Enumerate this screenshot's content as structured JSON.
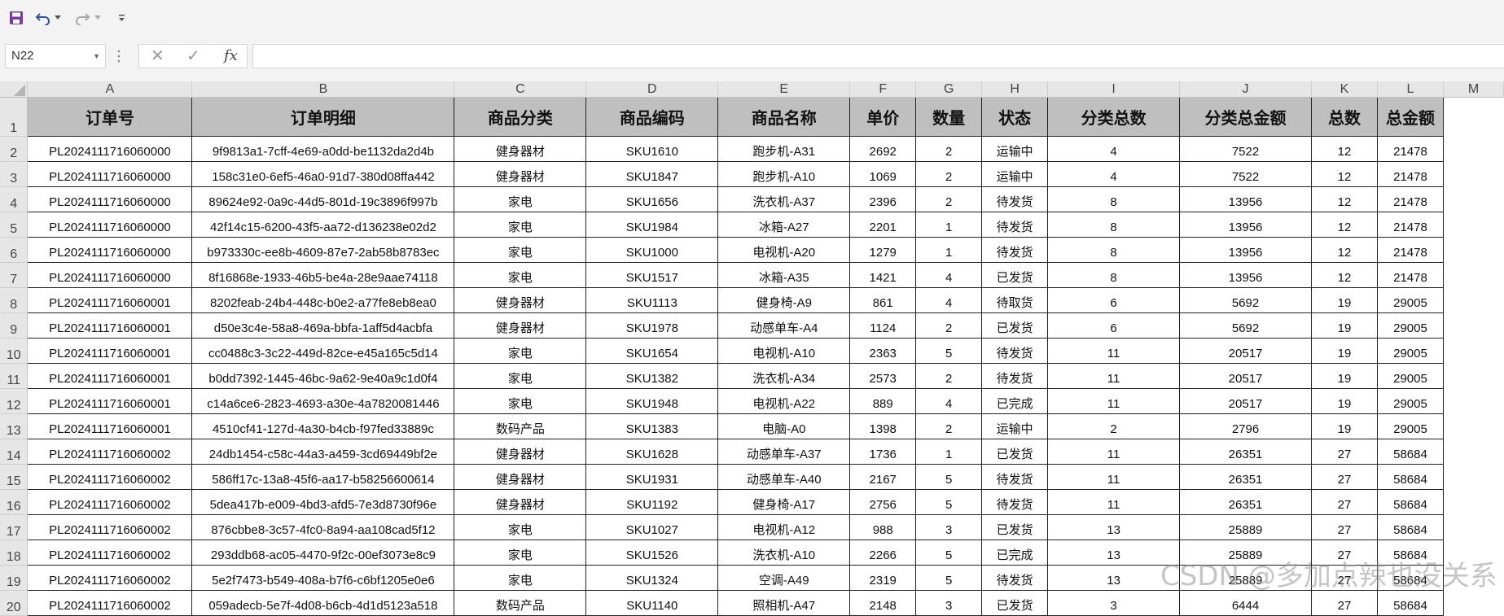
{
  "app": {
    "accent": "#217346",
    "save_color": "#7a3c9e"
  },
  "formula_bar": {
    "name_box": "N22",
    "cancel_symbol": "✕",
    "enter_symbol": "✓",
    "fx_label": "fx",
    "formula_value": ""
  },
  "columns": [
    "A",
    "B",
    "C",
    "D",
    "E",
    "F",
    "G",
    "H",
    "I",
    "J",
    "K",
    "L",
    "M"
  ],
  "row_numbers": [
    "1",
    "2",
    "3",
    "4",
    "5",
    "6",
    "7",
    "8",
    "9",
    "10",
    "11",
    "12",
    "13",
    "14",
    "15",
    "16",
    "17",
    "18",
    "19",
    "20"
  ],
  "header": [
    "订单号",
    "订单明细",
    "商品分类",
    "商品编码",
    "商品名称",
    "单价",
    "数量",
    "状态",
    "分类总数",
    "分类总金额",
    "总数",
    "总金额"
  ],
  "rows": [
    [
      "PL2024111716060000",
      "9f9813a1-7cff-4e69-a0dd-be1132da2d4b",
      "健身器材",
      "SKU1610",
      "跑步机-A31",
      "2692",
      "2",
      "运输中",
      "4",
      "7522",
      "12",
      "21478"
    ],
    [
      "PL2024111716060000",
      "158c31e0-6ef5-46a0-91d7-380d08ffa442",
      "健身器材",
      "SKU1847",
      "跑步机-A10",
      "1069",
      "2",
      "运输中",
      "4",
      "7522",
      "12",
      "21478"
    ],
    [
      "PL2024111716060000",
      "89624e92-0a9c-44d5-801d-19c3896f997b",
      "家电",
      "SKU1656",
      "洗衣机-A37",
      "2396",
      "2",
      "待发货",
      "8",
      "13956",
      "12",
      "21478"
    ],
    [
      "PL2024111716060000",
      "42f14c15-6200-43f5-aa72-d136238e02d2",
      "家电",
      "SKU1984",
      "冰箱-A27",
      "2201",
      "1",
      "待发货",
      "8",
      "13956",
      "12",
      "21478"
    ],
    [
      "PL2024111716060000",
      "b973330c-ee8b-4609-87e7-2ab58b8783ec",
      "家电",
      "SKU1000",
      "电视机-A20",
      "1279",
      "1",
      "待发货",
      "8",
      "13956",
      "12",
      "21478"
    ],
    [
      "PL2024111716060000",
      "8f16868e-1933-46b5-be4a-28e9aae74118",
      "家电",
      "SKU1517",
      "冰箱-A35",
      "1421",
      "4",
      "已发货",
      "8",
      "13956",
      "12",
      "21478"
    ],
    [
      "PL2024111716060001",
      "8202feab-24b4-448c-b0e2-a77fe8eb8ea0",
      "健身器材",
      "SKU1113",
      "健身椅-A9",
      "861",
      "4",
      "待取货",
      "6",
      "5692",
      "19",
      "29005"
    ],
    [
      "PL2024111716060001",
      "d50e3c4e-58a8-469a-bbfa-1aff5d4acbfa",
      "健身器材",
      "SKU1978",
      "动感单车-A4",
      "1124",
      "2",
      "已发货",
      "6",
      "5692",
      "19",
      "29005"
    ],
    [
      "PL2024111716060001",
      "cc0488c3-3c22-449d-82ce-e45a165c5d14",
      "家电",
      "SKU1654",
      "电视机-A10",
      "2363",
      "5",
      "待发货",
      "11",
      "20517",
      "19",
      "29005"
    ],
    [
      "PL2024111716060001",
      "b0dd7392-1445-46bc-9a62-9e40a9c1d0f4",
      "家电",
      "SKU1382",
      "洗衣机-A34",
      "2573",
      "2",
      "待发货",
      "11",
      "20517",
      "19",
      "29005"
    ],
    [
      "PL2024111716060001",
      "c14a6ce6-2823-4693-a30e-4a7820081446",
      "家电",
      "SKU1948",
      "电视机-A22",
      "889",
      "4",
      "已完成",
      "11",
      "20517",
      "19",
      "29005"
    ],
    [
      "PL2024111716060001",
      "4510cf41-127d-4a30-b4cb-f97fed33889c",
      "数码产品",
      "SKU1383",
      "电脑-A0",
      "1398",
      "2",
      "运输中",
      "2",
      "2796",
      "19",
      "29005"
    ],
    [
      "PL2024111716060002",
      "24db1454-c58c-44a3-a459-3cd69449bf2e",
      "健身器材",
      "SKU1628",
      "动感单车-A37",
      "1736",
      "1",
      "已发货",
      "11",
      "26351",
      "27",
      "58684"
    ],
    [
      "PL2024111716060002",
      "586ff17c-13a8-45f6-aa17-b58256600614",
      "健身器材",
      "SKU1931",
      "动感单车-A40",
      "2167",
      "5",
      "待发货",
      "11",
      "26351",
      "27",
      "58684"
    ],
    [
      "PL2024111716060002",
      "5dea417b-e009-4bd3-afd5-7e3d8730f96e",
      "健身器材",
      "SKU1192",
      "健身椅-A17",
      "2756",
      "5",
      "待发货",
      "11",
      "26351",
      "27",
      "58684"
    ],
    [
      "PL2024111716060002",
      "876cbbe8-3c57-4fc0-8a94-aa108cad5f12",
      "家电",
      "SKU1027",
      "电视机-A12",
      "988",
      "3",
      "已发货",
      "13",
      "25889",
      "27",
      "58684"
    ],
    [
      "PL2024111716060002",
      "293ddb68-ac05-4470-9f2c-00ef3073e8c9",
      "家电",
      "SKU1526",
      "洗衣机-A10",
      "2266",
      "5",
      "已完成",
      "13",
      "25889",
      "27",
      "58684"
    ],
    [
      "PL2024111716060002",
      "5e2f7473-b549-408a-b7f6-c6bf1205e0e6",
      "家电",
      "SKU1324",
      "空调-A49",
      "2319",
      "5",
      "待发货",
      "13",
      "25889",
      "27",
      "58684"
    ],
    [
      "PL2024111716060002",
      "059adecb-5e7f-4d08-b6cb-4d1d5123a518",
      "数码产品",
      "SKU1140",
      "照相机-A47",
      "2148",
      "3",
      "已发货",
      "3",
      "6444",
      "27",
      "58684"
    ]
  ],
  "watermark": "CSDN @多加点辣也没关系"
}
